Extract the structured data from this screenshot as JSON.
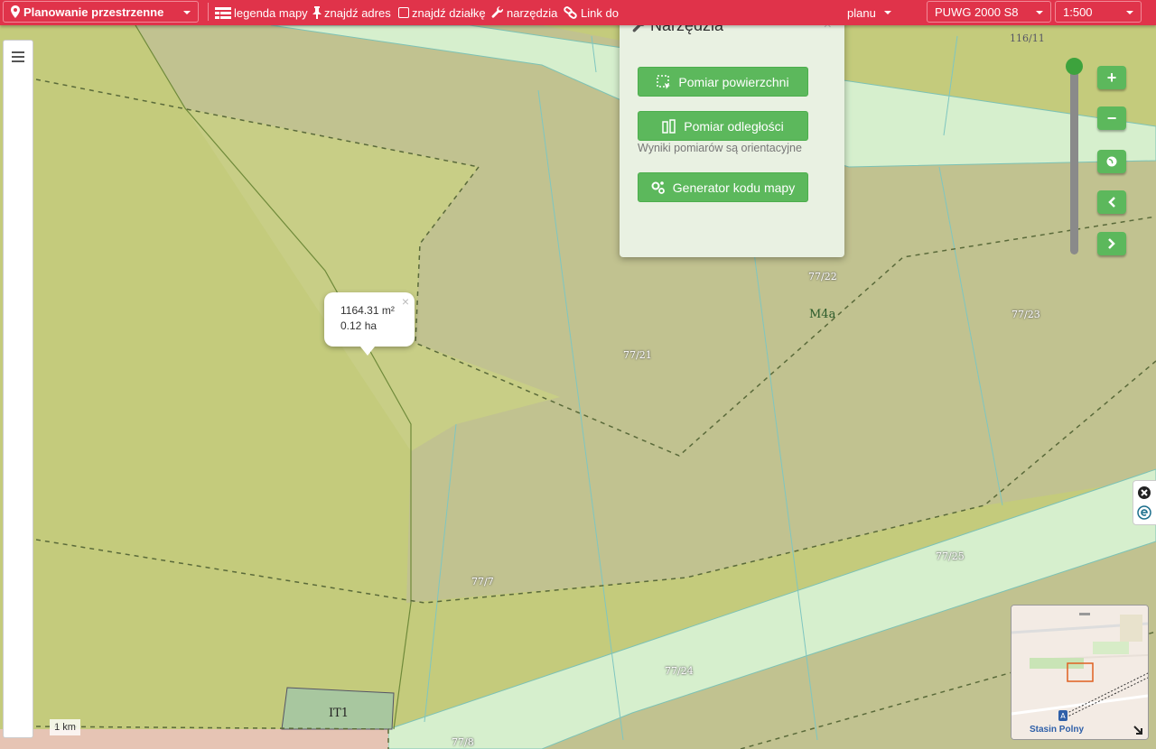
{
  "topbar": {
    "module_label": "Planowanie przestrzenne",
    "legend_label": "legenda mapy",
    "find_address_label": "znajdź adres",
    "find_parcel_label": "znajdź działkę",
    "tools_label": "narzędzia",
    "link_label": "Link do",
    "plan_label": "planu",
    "crs_label": "PUWG 2000 S8",
    "scale_label": "1:500"
  },
  "tools_panel": {
    "title": "Narzędzia",
    "area_button": "Pomiar powierzchni",
    "distance_button": "Pomiar odległości",
    "note": "Wyniki pomiarów są orientacyjne",
    "generator_button": "Generator kodu mapy"
  },
  "measure_popup": {
    "area_m2": "1164.31 m²",
    "area_ha": "0.12 ha"
  },
  "map_labels": {
    "p116_11": "116/11",
    "p77_22": "77/22",
    "m4a": "M4a",
    "p77_23": "77/23",
    "p77_21": "77/21",
    "p77_25": "77/25",
    "p77_7": "77/7",
    "p77_24": "77/24",
    "it1": "IT1",
    "p77_8": "77/8"
  },
  "scale_bar": "1 km",
  "overview_map": {
    "place_label": "Stasin Polny"
  },
  "colors": {
    "topbar": "#e0334a",
    "button_green": "#5cb85c",
    "zone_yellow_green": "#c4cb7c",
    "zone_olive": "#c0c08e",
    "road_light_green": "#d8f0d0"
  }
}
